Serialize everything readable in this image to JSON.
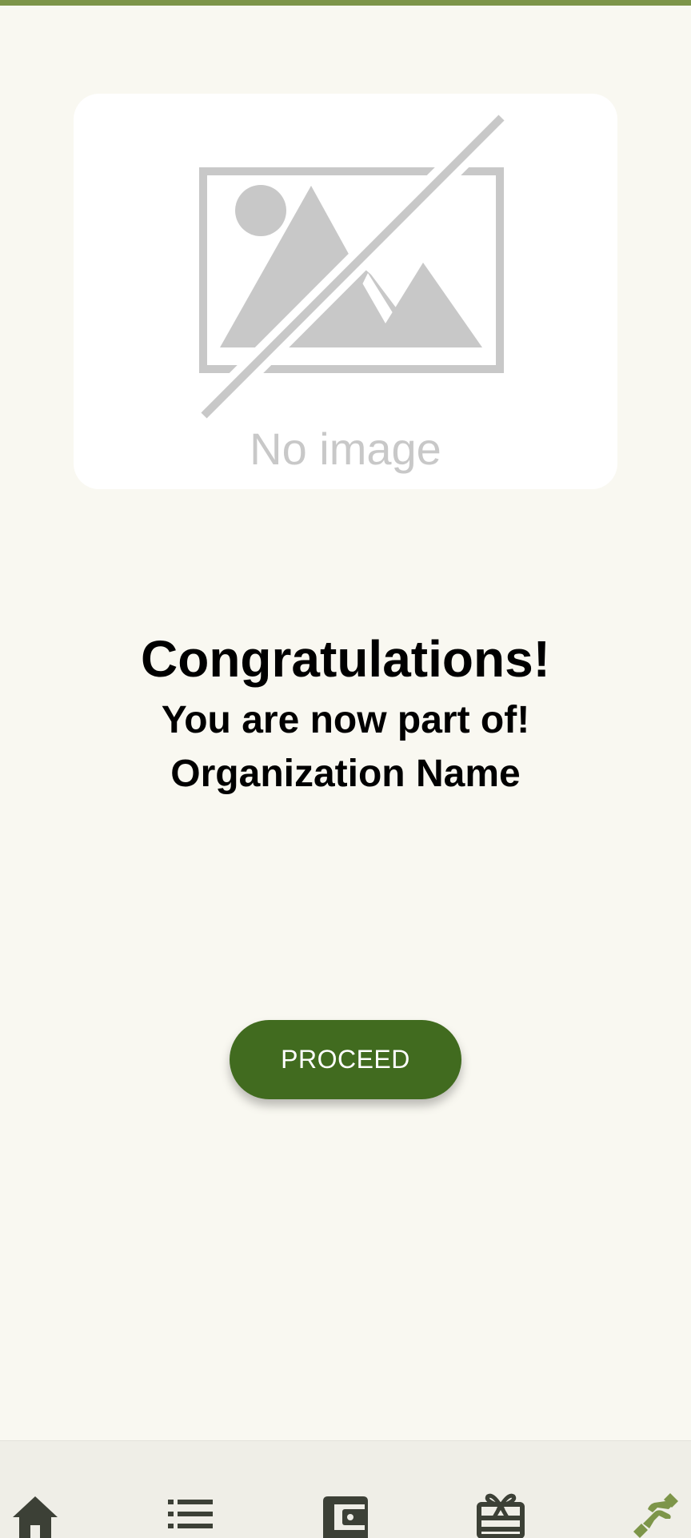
{
  "placeholder_image": {
    "label": "No image",
    "icon": "broken-image-icon"
  },
  "message": {
    "title": "Congratulations!",
    "line1": "You are now part of!",
    "line2": "Organization Name"
  },
  "actions": {
    "proceed_label": "PROCEED"
  },
  "bottom_nav": {
    "items": [
      {
        "icon": "home-icon",
        "active": false
      },
      {
        "icon": "list-icon",
        "active": false
      },
      {
        "icon": "wallet-icon",
        "active": false
      },
      {
        "icon": "gift-card-icon",
        "active": false
      },
      {
        "icon": "handshake-icon",
        "active": true
      }
    ]
  },
  "colors": {
    "accent": "#7d9549",
    "button": "#416b1f",
    "background": "#f9f8f1",
    "nav_icon": "#3c4036",
    "placeholder_gray": "#c8c8c8"
  }
}
